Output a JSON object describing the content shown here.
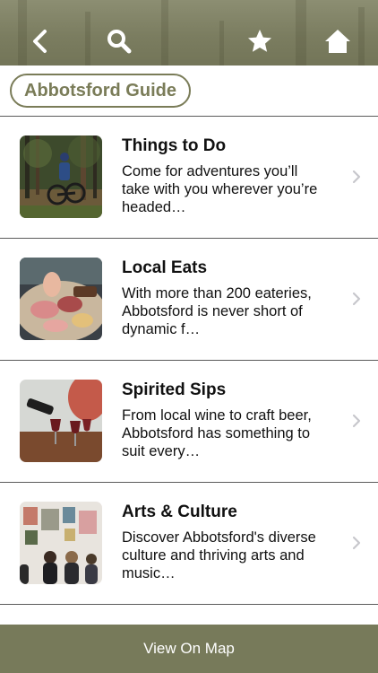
{
  "header": {
    "back_icon": "chevron-left-icon",
    "search_icon": "search-icon",
    "favorites_icon": "star-icon",
    "home_icon": "home-icon",
    "bar_color": "#7b7d60"
  },
  "guide": {
    "label": "Abbotsford Guide",
    "accent": "#7a7c58"
  },
  "items": [
    {
      "title": "Things to Do",
      "description": "Come for adventures you’ll take with you wherever you’re headed…",
      "image": "mountain-biker-in-forest"
    },
    {
      "title": "Local Eats",
      "description": "With more than 200 eateries, Abbotsford is never short of dynamic f…",
      "image": "charcuterie-board"
    },
    {
      "title": "Spirited Sips",
      "description": "From local wine to craft beer, Abbotsford has something to suit every…",
      "image": "wine-glasses-being-poured"
    },
    {
      "title": "Arts & Culture",
      "description": "Discover Abbotsford's diverse culture and thriving arts and music…",
      "image": "art-gallery-visitors"
    }
  ],
  "footer": {
    "label": "View On Map"
  }
}
